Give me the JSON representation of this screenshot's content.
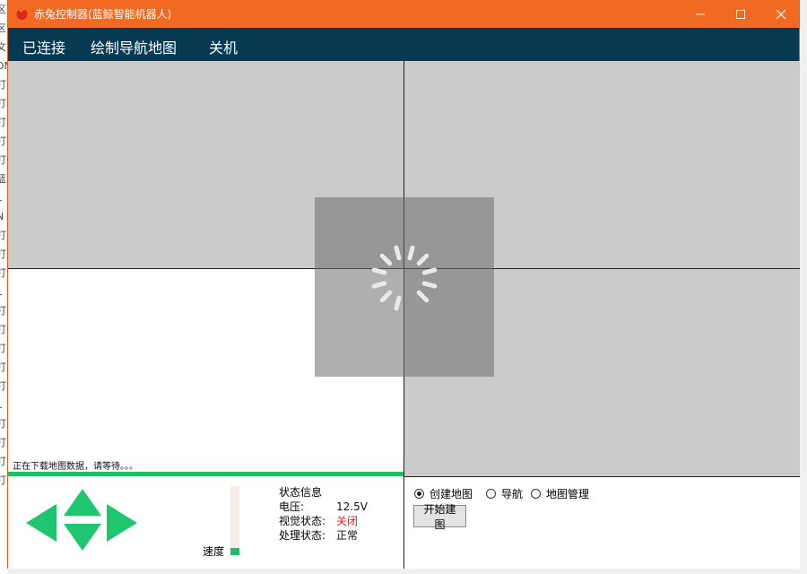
{
  "window": {
    "title": "赤兔控制器(蓝鲸智能机器人)"
  },
  "background_fragments": [
    "区",
    "区",
    "文",
    "DN",
    "打",
    "打",
    "打",
    "打",
    "打",
    "蓝",
    "L",
    "N",
    "打",
    "打",
    "打",
    "L",
    "打",
    "打",
    "打",
    "打",
    "打",
    "L",
    "打",
    "打",
    "打",
    "打"
  ],
  "menu": {
    "items": [
      "已连接",
      "绘制导航地图",
      "关机"
    ]
  },
  "map_panel": {
    "download_text": "正在下载地图数据，请等待。。。",
    "download_progress": 1.0
  },
  "controls": {
    "speed_label": "速度",
    "speed_level": 0.1,
    "colors": {
      "accent": "#1fbf66",
      "title_bar": "#f26a21",
      "menu_bar": "#063a53"
    }
  },
  "status": {
    "heading": "状态信息",
    "rows": [
      {
        "label": "电压:",
        "value": "12.5V",
        "color": "#111111"
      },
      {
        "label": "视觉状态:",
        "value": "关闭",
        "color": "#e0261b"
      },
      {
        "label": "处理状态:",
        "value": "正常",
        "color": "#111111"
      }
    ]
  },
  "mode": {
    "options": [
      "创建地图",
      "导航",
      "地图管理"
    ],
    "selected": "创建地图",
    "action_button": "开始建图"
  },
  "icons": {
    "app": "red-flame-icon",
    "minimize": "minimize-icon",
    "maximize": "maximize-icon",
    "close": "close-icon",
    "spinner": "loading-spinner-icon"
  }
}
